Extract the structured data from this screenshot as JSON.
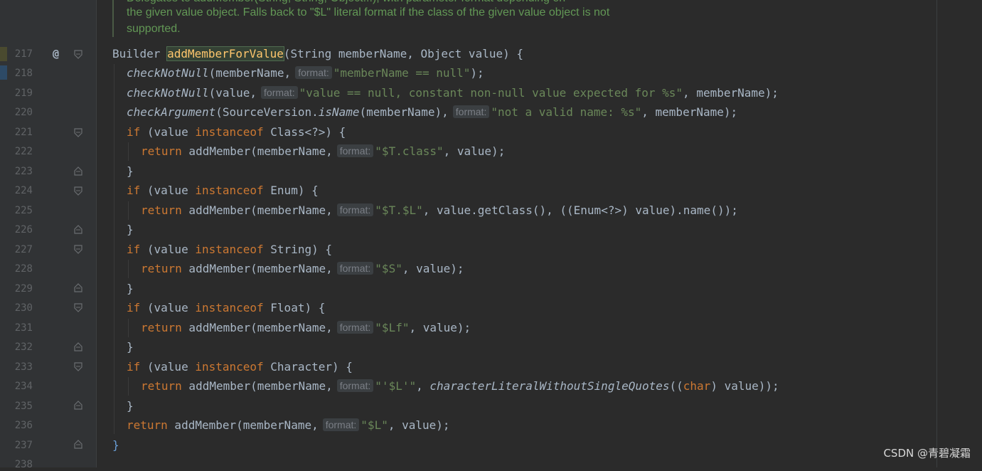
{
  "doc_comment": {
    "lines": [
      "Delegates to addMember(String, String, Object...), with parameter format depending on",
      "the given value object. Falls back to \"$L\" literal format if the class of the given value object is not",
      "supported."
    ]
  },
  "line_numbers": [
    "217",
    "218",
    "219",
    "220",
    "221",
    "222",
    "223",
    "224",
    "225",
    "226",
    "227",
    "228",
    "229",
    "230",
    "231",
    "232",
    "233",
    "234",
    "235",
    "236",
    "237",
    "238"
  ],
  "hint_label": "format:",
  "code": {
    "l217": {
      "ret": "Builder",
      "name": "addMemberForValue",
      "params": "(String memberName, Object value) {"
    },
    "l218": {
      "call": "checkNotNull",
      "open": "(memberName,",
      "str": "\"memberName == null\"",
      "close": ");"
    },
    "l219": {
      "call": "checkNotNull",
      "open": "(value,",
      "str": "\"value == null, constant non-null value expected for %s\"",
      "close": ", memberName);"
    },
    "l220": {
      "call": "checkArgument",
      "open": "(SourceVersion.",
      "call2": "isName",
      "open2": "(memberName),",
      "str": "\"not a valid name: %s\"",
      "close": ", memberName);"
    },
    "l221": {
      "kw": "if",
      "a": " (value ",
      "kw2": "instanceof",
      "b": " Class<?>) {"
    },
    "l222": {
      "kw": "return",
      "a": " addMember(memberName,",
      "str": "\"$T.class\"",
      "close": ", value);"
    },
    "l223": {
      "brace": "}"
    },
    "l224": {
      "kw": "if",
      "a": " (value ",
      "kw2": "instanceof",
      "b": " Enum) {"
    },
    "l225": {
      "kw": "return",
      "a": " addMember(memberName,",
      "str": "\"$T.$L\"",
      "close": ", value.getClass(), ((Enum<?>) value).name());"
    },
    "l226": {
      "brace": "}"
    },
    "l227": {
      "kw": "if",
      "a": " (value ",
      "kw2": "instanceof",
      "b": " String) {"
    },
    "l228": {
      "kw": "return",
      "a": " addMember(memberName,",
      "str": "\"$S\"",
      "close": ", value);"
    },
    "l229": {
      "brace": "}"
    },
    "l230": {
      "kw": "if",
      "a": " (value ",
      "kw2": "instanceof",
      "b": " Float) {"
    },
    "l231": {
      "kw": "return",
      "a": " addMember(memberName,",
      "str": "\"$Lf\"",
      "close": ", value);"
    },
    "l232": {
      "brace": "}"
    },
    "l233": {
      "kw": "if",
      "a": " (value ",
      "kw2": "instanceof",
      "b": " Character) {"
    },
    "l234": {
      "kw": "return",
      "a": " addMember(memberName,",
      "str": "\"'$L'\"",
      "mid": ", ",
      "call": "characterLiteralWithoutSingleQuotes",
      "open": "((",
      "kw2": "char",
      "close": ") value));"
    },
    "l235": {
      "brace": "}"
    },
    "l236": {
      "kw": "return",
      "a": " addMember(memberName,",
      "str": "\"$L\"",
      "close": ", value);"
    },
    "l237": {
      "brace": "}"
    }
  },
  "watermark": "CSDN @青碧凝霜"
}
